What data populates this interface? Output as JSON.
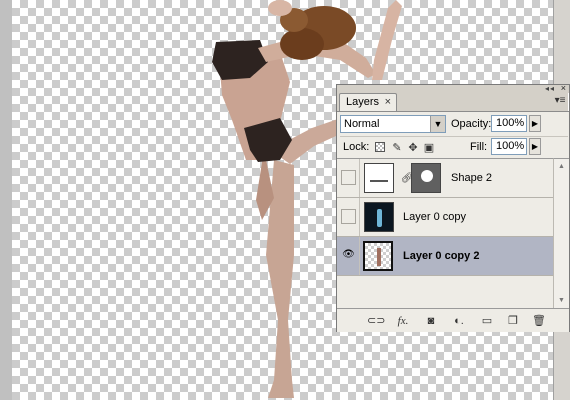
{
  "layers_panel": {
    "tab_label": "Layers",
    "tab_close": "×",
    "menu_icon": "panel-menu-icon",
    "blend_mode": "Normal",
    "opacity_label": "Opacity:",
    "opacity_value": "100%",
    "lock_label": "Lock:",
    "fill_label": "Fill:",
    "fill_value": "100%",
    "lock_icons": [
      "lock-transparent-pixels-icon",
      "lock-image-pixels-icon",
      "lock-position-icon",
      "lock-all-icon"
    ],
    "layers": [
      {
        "name": "Shape 2",
        "visible": false,
        "selected": false,
        "thumb": "white",
        "has_mask": true
      },
      {
        "name": "Layer 0 copy",
        "visible": false,
        "selected": false,
        "thumb": "dark",
        "has_mask": false
      },
      {
        "name": "Layer 0 copy 2",
        "visible": true,
        "selected": true,
        "thumb": "transparent",
        "has_mask": false
      }
    ],
    "bottom_icons": [
      "link-layers-icon",
      "layer-style-icon",
      "add-mask-icon",
      "adjustment-layer-icon",
      "new-group-icon",
      "new-layer-icon",
      "delete-layer-icon"
    ]
  },
  "colors": {
    "panel_bg": "#d4d0c8",
    "list_bg": "#eeece6",
    "selected_row": "#b1b5c4"
  }
}
